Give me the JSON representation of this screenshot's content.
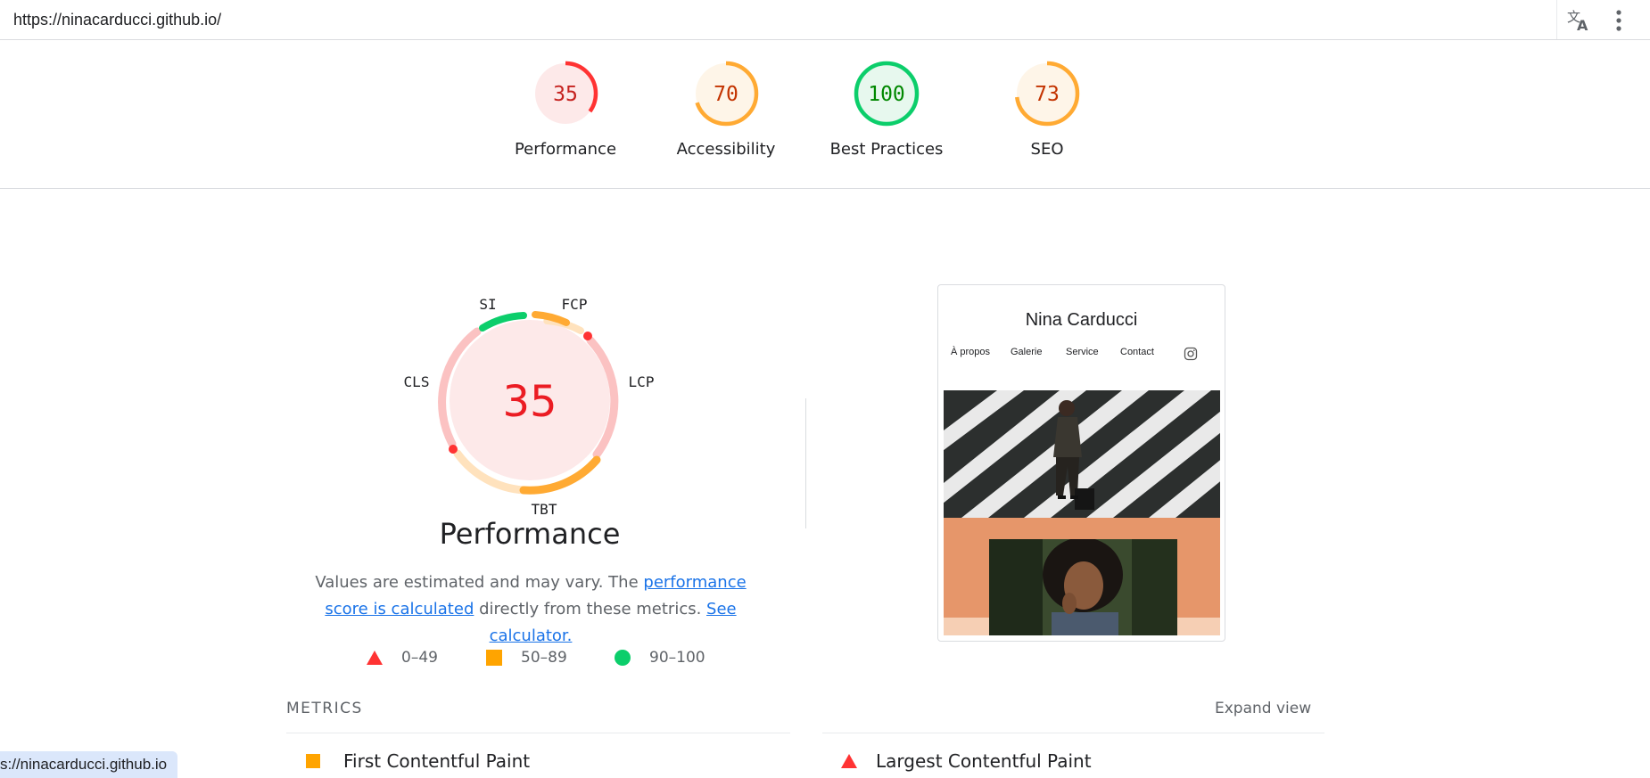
{
  "browser": {
    "url": "https://ninacarducci.github.io/",
    "status_url": "s://ninacarducci.github.io"
  },
  "categories": [
    {
      "score": "35",
      "label": "Performance",
      "value": 35,
      "color": "#ff3333",
      "bg": "#fde9e9",
      "text_color": "#c5221f"
    },
    {
      "score": "70",
      "label": "Accessibility",
      "value": 70,
      "color": "#ffaa33",
      "bg": "#fef5e8",
      "text_color": "#c33300"
    },
    {
      "score": "100",
      "label": "Best Practices",
      "value": 100,
      "color": "#0cce6b",
      "bg": "#e7f8ee",
      "text_color": "#008800"
    },
    {
      "score": "73",
      "label": "SEO",
      "value": 73,
      "color": "#ffaa33",
      "bg": "#fef5e8",
      "text_color": "#c33300"
    }
  ],
  "performance": {
    "score": "35",
    "title": "Performance",
    "metric_labels": {
      "si": "SI",
      "fcp": "FCP",
      "lcp": "LCP",
      "tbt": "TBT",
      "cls": "CLS"
    },
    "description_prefix": "Values are estimated and may vary. The ",
    "description_link": "performance score is calculated",
    "description_middle": " directly from these metrics. ",
    "calculator_link": "See calculator."
  },
  "legend": [
    {
      "shape": "triangle",
      "range": "0–49",
      "color": "#ff3333"
    },
    {
      "shape": "square",
      "range": "50–89",
      "color": "#ffa400"
    },
    {
      "shape": "circle",
      "range": "90–100",
      "color": "#0cce6b"
    }
  ],
  "preview": {
    "site_title": "Nina Carducci",
    "nav": [
      "À propos",
      "Galerie",
      "Service",
      "Contact"
    ]
  },
  "metrics": {
    "heading": "METRICS",
    "expand_label": "Expand view",
    "items": [
      {
        "label": "First Contentful Paint",
        "status": "average"
      },
      {
        "label": "Largest Contentful Paint",
        "status": "fail"
      }
    ]
  }
}
